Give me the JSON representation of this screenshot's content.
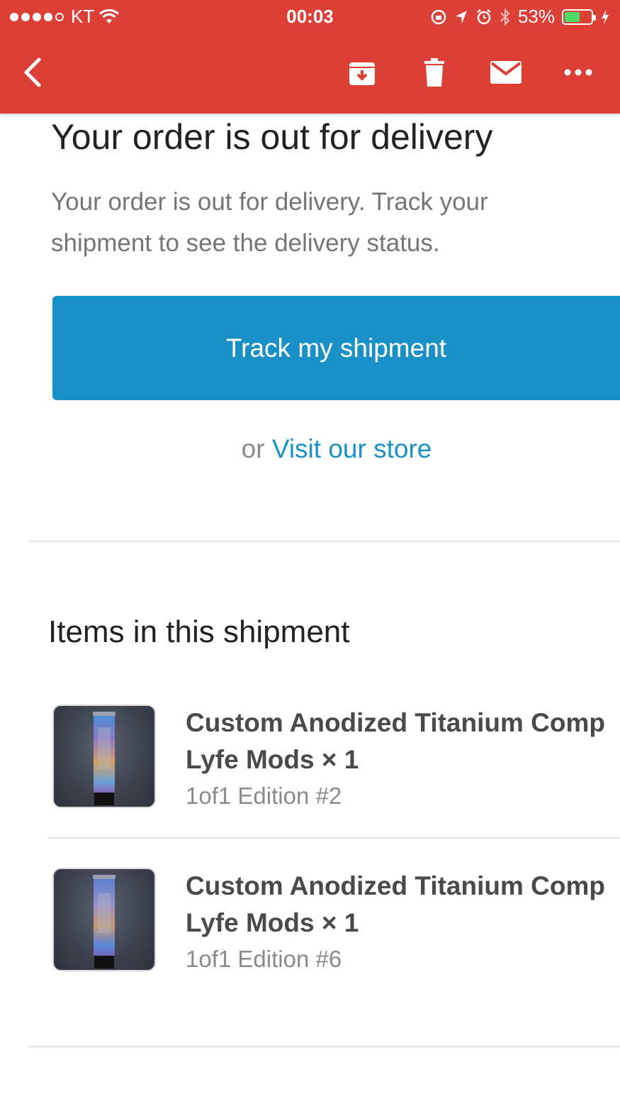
{
  "status_bar": {
    "carrier": "KT",
    "time": "00:03",
    "battery": "53%",
    "battery_level": 0.53
  },
  "toolbar": {
    "back_icon": "chevron-left-icon",
    "archive_icon": "archive-icon",
    "delete_icon": "trash-icon",
    "mark_unread_icon": "mail-icon",
    "more_icon": "more-horizontal-icon"
  },
  "email": {
    "headline": "Your order is out for delivery",
    "body": "Your order is out for delivery. Track your shipment to see the delivery status.",
    "track_button": "Track my shipment",
    "or_text": "or",
    "store_link": "Visit our store"
  },
  "shipment": {
    "title": "Items in this shipment",
    "items": [
      {
        "name": "Custom Anodized Titanium Comp",
        "brand": "Lyfe Mods × 1",
        "variant": "1of1 Edition #2"
      },
      {
        "name": "Custom Anodized Titanium Comp",
        "brand": "Lyfe Mods × 1",
        "variant": "1of1 Edition #6"
      }
    ]
  },
  "colors": {
    "header_red": "#dc3f35",
    "button_blue": "#1990c6",
    "battery_green": "#4cd964"
  }
}
